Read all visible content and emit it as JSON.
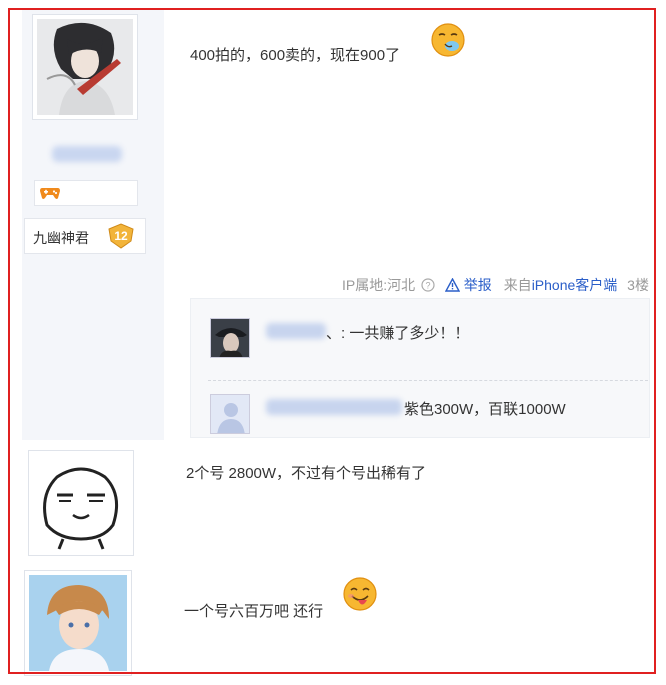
{
  "posts": [
    {
      "username": "九幽神君",
      "level": "12",
      "text": "400拍的，600卖的，现在900了",
      "emoji_icon": "sneeze-emoji-icon",
      "meta": {
        "ip_label": "IP属地:河北",
        "report_label": "举报",
        "from_prefix": "来自",
        "from_client": "iPhone客户端",
        "floor": "3楼"
      },
      "replies": [
        {
          "text": "、: 一共赚了多少！！"
        },
        {
          "text": "紫色300W，百联1000W"
        }
      ]
    },
    {
      "text": "2个号 2800W，不过有个号出稀有了"
    },
    {
      "text": "一个号六百万吧 还行",
      "emoji_icon": "tongue-out-emoji-icon"
    }
  ],
  "colors": {
    "frame": "#e02020",
    "link": "#2a5ec8",
    "sidebar": "#f4f6fa",
    "level_badge": "#f2b43a"
  }
}
